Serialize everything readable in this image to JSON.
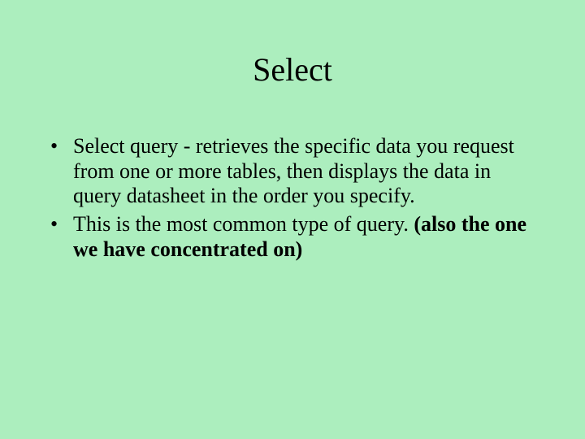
{
  "slide": {
    "title": "Select",
    "bullets": [
      {
        "text": "Select query - retrieves the specific data you request from one or more tables, then displays the data in query datasheet in the order you specify."
      },
      {
        "text": "This is the most common type of query. ",
        "bold_suffix": "(also the one we have concentrated on)"
      }
    ]
  }
}
